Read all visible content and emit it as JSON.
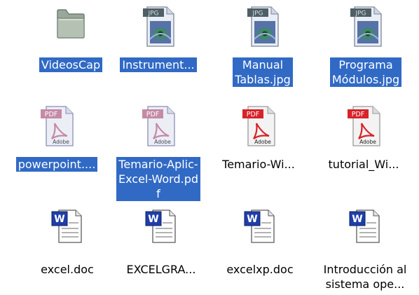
{
  "files": [
    {
      "name": "VideosCap",
      "type": "folder",
      "selected": true
    },
    {
      "name": "Instrument...",
      "type": "jpg",
      "selected": true,
      "badge": "JPG"
    },
    {
      "name": "Manual\nTablas.jpg",
      "type": "jpg",
      "selected": true,
      "badge": "JPG"
    },
    {
      "name": "Programa\nMódulos.jpg",
      "type": "jpg",
      "selected": true,
      "badge": "JPG"
    },
    {
      "name": "powerpoint....",
      "type": "pdf",
      "selected": true,
      "badge": "PDF",
      "vendor": "Adobe"
    },
    {
      "name": "Temario-Aplic-\nExcel-Word.pd\nf",
      "type": "pdf",
      "selected": true,
      "badge": "PDF",
      "vendor": "Adobe"
    },
    {
      "name": "Temario-Wi...",
      "type": "pdf",
      "selected": false,
      "badge": "PDF",
      "vendor": "Adobe"
    },
    {
      "name": "tutorial_Wi...",
      "type": "pdf",
      "selected": false,
      "badge": "PDF",
      "vendor": "Adobe"
    },
    {
      "name": "excel.doc",
      "type": "doc",
      "selected": false,
      "badge": "W"
    },
    {
      "name": "EXCELGRA...",
      "type": "doc",
      "selected": false,
      "badge": "W"
    },
    {
      "name": "excelxp.doc",
      "type": "doc",
      "selected": false,
      "badge": "W"
    },
    {
      "name": "Introducción al\nsistema ope...",
      "type": "doc",
      "selected": false,
      "badge": "W"
    }
  ],
  "colors": {
    "selection": "#316ac5",
    "pdf_badge_faded": "#c58aa6",
    "pdf_badge": "#d8232a",
    "jpg_badge": "#4f5f66",
    "word_blue": "#1e3ea8"
  }
}
